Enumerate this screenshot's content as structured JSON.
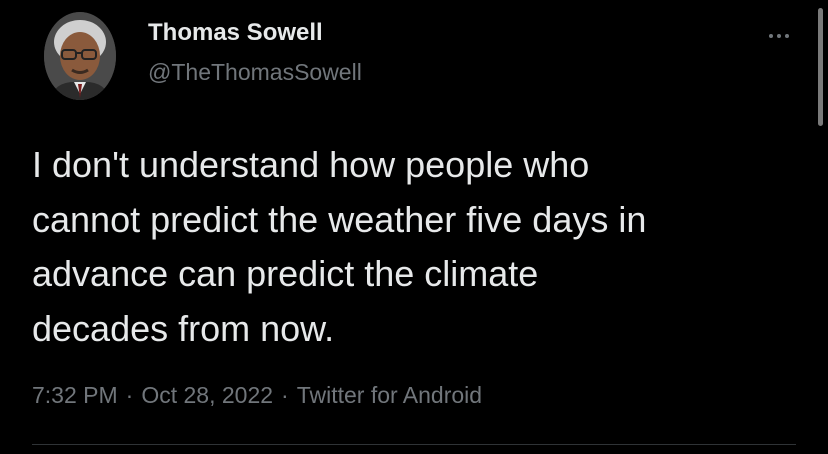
{
  "author": {
    "display_name": "Thomas Sowell",
    "handle": "@TheThomasSowell"
  },
  "tweet": {
    "text_lines": [
      "I don't understand how people who",
      "cannot predict the weather five days in",
      "advance can predict the climate",
      "decades from now."
    ],
    "time": "7:32 PM",
    "date": "Oct 28, 2022",
    "source": "Twitter for Android",
    "separator": "·"
  },
  "icons": {
    "more": "more-horizontal-icon",
    "avatar": "profile-photo"
  },
  "colors": {
    "background": "#000000",
    "primary_text": "#e7e9ea",
    "secondary_text": "#71767b",
    "divider": "#2f3336"
  }
}
